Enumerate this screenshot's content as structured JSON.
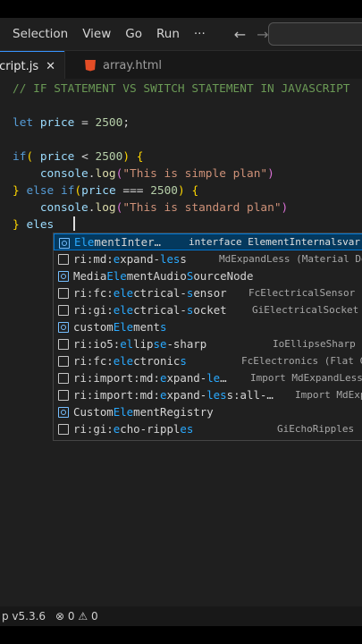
{
  "menubar": {
    "items": [
      "Selection",
      "View",
      "Go",
      "Run",
      "···"
    ],
    "back_icon": "arrow-left-icon",
    "forward_icon": "arrow-right-icon"
  },
  "tabs": [
    {
      "label": "script.js",
      "visible_label": "script.js",
      "active": true
    },
    {
      "label": "array.html",
      "active": false
    }
  ],
  "editor": {
    "comment": "// IF STATEMENT VS SWITCH STATEMENT IN JAVASCRIPT",
    "price_value": "2500",
    "log1": "\"This is simple plan\"",
    "log2": "\"This is standard plan\"",
    "typed": "eles"
  },
  "suggestions": [
    {
      "pre": "",
      "match": "Ele",
      "mid": "mentInter",
      "match2": "",
      "post": "…",
      "detail": "interface ElementInternalsvar",
      "icon": "sym",
      "selected": true
    },
    {
      "pre": "ri:md:",
      "match": "e",
      "mid": "xpand-",
      "match2": "les",
      "post": "s",
      "detail": "MdExpandLess (Material De",
      "icon": "text"
    },
    {
      "pre": "Media",
      "match": "Ele",
      "mid": "mentAudio",
      "match2": "S",
      "post": "ourceNode",
      "detail": "",
      "icon": "sym"
    },
    {
      "pre": "ri:fc:",
      "match": "ele",
      "mid": "ctrical-",
      "match2": "s",
      "post": "ensor",
      "detail": "FcElectricalSensor (",
      "icon": "text"
    },
    {
      "pre": "ri:gi:",
      "match": "ele",
      "mid": "ctrical-",
      "match2": "s",
      "post": "ocket",
      "detail": "GiElectricalSocket (",
      "icon": "text"
    },
    {
      "pre": "custom",
      "match": "Ele",
      "mid": "ment",
      "match2": "s",
      "post": "",
      "detail": "",
      "icon": "sym"
    },
    {
      "pre": "ri:io5:",
      "match": "el",
      "mid": "lip",
      "match2": "se",
      "post": "-sharp",
      "detail": "IoEllipseSharp (",
      "icon": "text"
    },
    {
      "pre": "ri:fc:",
      "match": "ele",
      "mid": "ctronic",
      "match2": "s",
      "post": "",
      "detail": "FcElectronics (Flat C",
      "icon": "text"
    },
    {
      "pre": "ri:import:md:",
      "match": "e",
      "mid": "xpand-",
      "match2": "le",
      "post": "…",
      "detail": "Import MdExpandLess",
      "icon": "text"
    },
    {
      "pre": "ri:import:md:",
      "match": "e",
      "mid": "xpand-",
      "match2": "les",
      "post": "s:all-…",
      "detail": "Import MdExp",
      "icon": "text"
    },
    {
      "pre": "Custom",
      "match": "Ele",
      "mid": "mentRegistry",
      "match2": "",
      "post": "",
      "detail": "",
      "icon": "sym"
    },
    {
      "pre": "ri:gi:",
      "match": "e",
      "mid": "cho-rippl",
      "match2": "es",
      "post": "",
      "detail": "GiEchoRipples (",
      "icon": "text"
    }
  ],
  "status": {
    "version": "p v5.3.6",
    "errors": "0",
    "warnings": "0"
  }
}
